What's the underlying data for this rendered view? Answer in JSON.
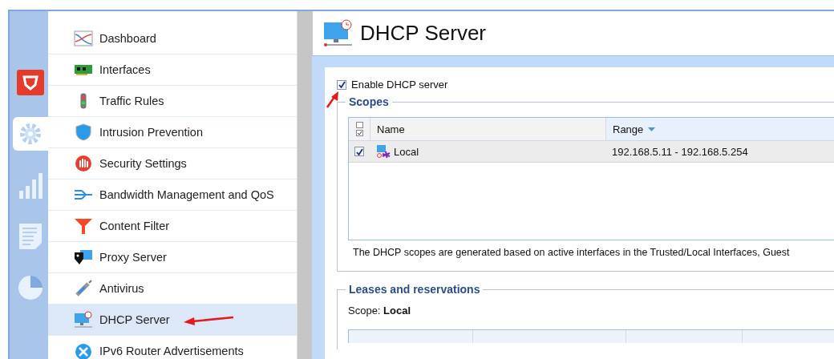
{
  "rail": [
    {
      "kind": "shield",
      "selected": false
    },
    {
      "kind": "gear",
      "selected": true
    },
    {
      "kind": "bars",
      "selected": false
    },
    {
      "kind": "report",
      "selected": false
    },
    {
      "kind": "pie",
      "selected": false
    }
  ],
  "nav": {
    "items": [
      {
        "label": "Dashboard",
        "kind": "dashboard",
        "selected": false
      },
      {
        "label": "Interfaces",
        "kind": "card",
        "selected": false
      },
      {
        "label": "Traffic Rules",
        "kind": "light",
        "selected": false
      },
      {
        "label": "Intrusion Prevention",
        "kind": "shield",
        "selected": false
      },
      {
        "label": "Security Settings",
        "kind": "hand",
        "selected": false
      },
      {
        "label": "Bandwidth Management and QoS",
        "kind": "arrows",
        "selected": false
      },
      {
        "label": "Content Filter",
        "kind": "funnel",
        "selected": false
      },
      {
        "label": "Proxy Server",
        "kind": "mask",
        "selected": false
      },
      {
        "label": "Antivirus",
        "kind": "syringe",
        "selected": false
      },
      {
        "label": "DHCP Server",
        "kind": "monitor",
        "selected": true
      },
      {
        "label": "IPv6 Router Advertisements",
        "kind": "network",
        "selected": false
      }
    ]
  },
  "page": {
    "title": "DHCP Server"
  },
  "enable": {
    "label": "Enable DHCP server",
    "checked": true
  },
  "scopes": {
    "title": "Scopes",
    "columns": [
      {
        "label": "Name",
        "sorted": false
      },
      {
        "label": "Range",
        "sorted": true
      }
    ],
    "rows": [
      {
        "checked": true,
        "name": "Local",
        "range": "192.168.5.11 - 192.168.5.254"
      }
    ],
    "note": "The DHCP scopes are generated based on active interfaces in the Trusted/Local Interfaces, Guest"
  },
  "leases": {
    "title": "Leases and reservations",
    "scope_label": "Scope:",
    "scope_value": "Local"
  }
}
